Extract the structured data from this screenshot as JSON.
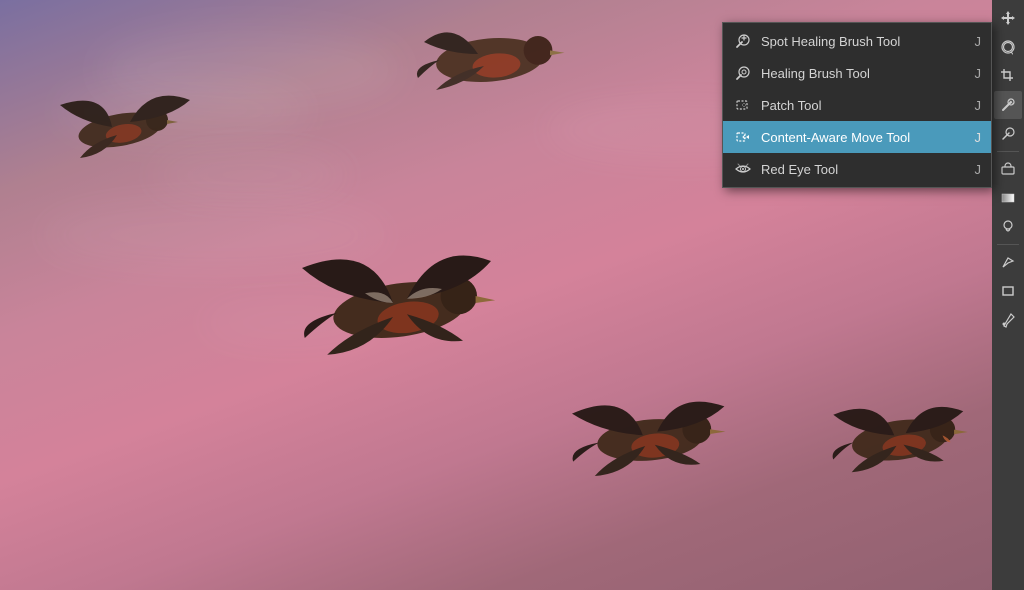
{
  "canvas": {
    "alt": "Ducks flying against sunset sky"
  },
  "toolbar": {
    "items": [
      {
        "name": "move-tool",
        "icon": "move",
        "active": false
      },
      {
        "name": "lasso-tool",
        "icon": "lasso",
        "active": false
      },
      {
        "name": "crop-tool",
        "icon": "crop",
        "active": false
      },
      {
        "name": "healing-brush-tool",
        "icon": "healing",
        "active": true
      },
      {
        "name": "clone-stamp-tool",
        "icon": "stamp",
        "active": false
      },
      {
        "name": "eraser-tool",
        "icon": "eraser",
        "active": false
      },
      {
        "name": "gradient-tool",
        "icon": "gradient",
        "active": false
      },
      {
        "name": "dodge-tool",
        "icon": "dodge",
        "active": false
      },
      {
        "name": "pen-tool",
        "icon": "pen",
        "active": false
      },
      {
        "name": "type-tool",
        "icon": "type",
        "active": false
      },
      {
        "name": "shape-tool",
        "icon": "shape",
        "active": false
      },
      {
        "name": "eyedropper-tool",
        "icon": "eyedropper",
        "active": false
      }
    ]
  },
  "dropdown": {
    "items": [
      {
        "id": "spot-healing",
        "label": "Spot Healing Brush Tool",
        "shortcut": "J",
        "active": false,
        "icon": "spot-healing"
      },
      {
        "id": "healing-brush",
        "label": "Healing Brush Tool",
        "shortcut": "J",
        "active": false,
        "icon": "healing-brush"
      },
      {
        "id": "patch-tool",
        "label": "Patch Tool",
        "shortcut": "J",
        "active": false,
        "icon": "patch"
      },
      {
        "id": "content-aware-move",
        "label": "Content-Aware Move Tool",
        "shortcut": "J",
        "active": true,
        "icon": "content-aware"
      },
      {
        "id": "red-eye",
        "label": "Red Eye Tool",
        "shortcut": "J",
        "active": false,
        "icon": "red-eye"
      }
    ]
  }
}
